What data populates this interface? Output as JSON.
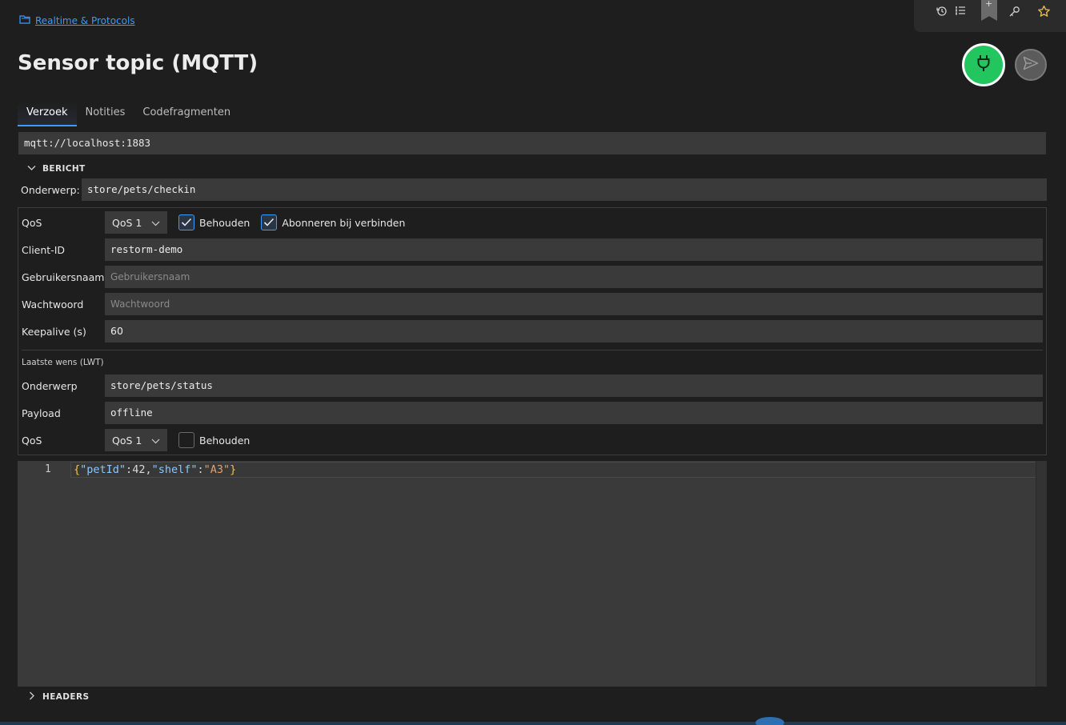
{
  "breadcrumb": {
    "label": "Realtime & Protocols"
  },
  "page": {
    "title": "Sensor topic (MQTT)"
  },
  "topbar": {
    "icons": [
      "history-icon",
      "list-icon",
      "bookmark-add-icon",
      "key-icon",
      "star-icon"
    ],
    "bookmark_plus": "+"
  },
  "tabs": [
    "Verzoek",
    "Notities",
    "Codefragmenten"
  ],
  "url": "mqtt://localhost:1883",
  "sections": {
    "message": "BERICHT",
    "headers": "HEADERS"
  },
  "message": {
    "topic_label": "Onderwerp:",
    "topic_value": "store/pets/checkin"
  },
  "options": {
    "qos_label": "QoS",
    "qos_value": "QoS 1",
    "retain_label": "Behouden",
    "retain_checked": true,
    "subscribe_label": "Abonneren bij verbinden",
    "subscribe_checked": true,
    "client_id_label": "Client-ID",
    "client_id_value": "restorm-demo",
    "username_label": "Gebruikersnaam",
    "username_placeholder": "Gebruikersnaam",
    "password_label": "Wachtwoord",
    "password_placeholder": "Wachtwoord",
    "keepalive_label": "Keepalive (s)",
    "keepalive_value": "60"
  },
  "lwt": {
    "title": "Laatste wens (LWT)",
    "topic_label": "Onderwerp",
    "topic_value": "store/pets/status",
    "payload_label": "Payload",
    "payload_value": "offline",
    "qos_label": "QoS",
    "qos_value": "QoS 1",
    "retain_label": "Behouden",
    "retain_checked": false
  },
  "editor": {
    "line_number": "1",
    "tokens": {
      "open": "{",
      "key1": "\"petId\"",
      "colon1": ":",
      "num1": "42",
      "comma": ",",
      "key2": "\"shelf\"",
      "colon2": ":",
      "str2": "\"A3\"",
      "close": "}"
    }
  },
  "colors": {
    "accent": "#3a9bff",
    "connect": "#22c55e",
    "background": "#1e1e1e",
    "field": "#3a3a3a"
  }
}
